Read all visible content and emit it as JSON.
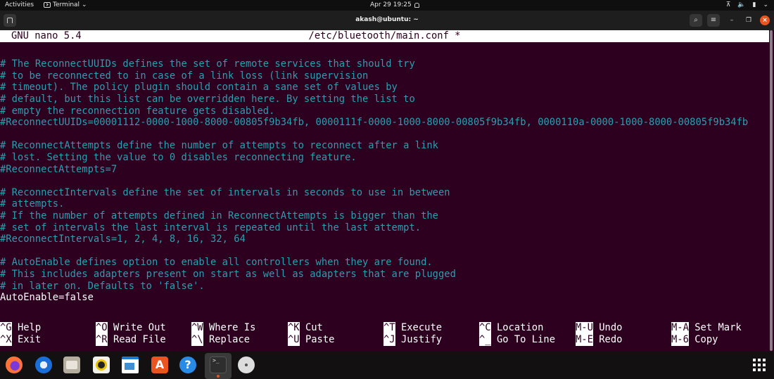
{
  "topbar": {
    "activities": "Activities",
    "app_menu": "Terminal",
    "app_menu_chevron": "⌄",
    "clock": "Apr 29  19:25",
    "tray": {
      "network_icon": "⊼",
      "volume_icon": "🔈",
      "battery_icon": "▮",
      "chevron_icon": "⌄"
    }
  },
  "window": {
    "title": "akash@ubuntu: ~",
    "search_icon": "⌕",
    "menu_icon": "≡",
    "minimize_icon": "–",
    "maximize_icon": "❐",
    "close_icon": "×"
  },
  "nano": {
    "version": "GNU nano 5.4",
    "filename": "/etc/bluetooth/main.conf *",
    "lines": [
      {
        "type": "blank",
        "text": ""
      },
      {
        "type": "comment",
        "text": "# The ReconnectUUIDs defines the set of remote services that should try"
      },
      {
        "type": "comment",
        "text": "# to be reconnected to in case of a link loss (link supervision"
      },
      {
        "type": "comment",
        "text": "# timeout). The policy plugin should contain a sane set of values by"
      },
      {
        "type": "comment",
        "text": "# default, but this list can be overridden here. By setting the list to"
      },
      {
        "type": "comment",
        "text": "# empty the reconnection feature gets disabled."
      },
      {
        "type": "comment",
        "text": "#ReconnectUUIDs=00001112-0000-1000-8000-00805f9b34fb, 0000111f-0000-1000-8000-00805f9b34fb, 0000110a-0000-1000-8000-00805f9b34fb"
      },
      {
        "type": "blank",
        "text": ""
      },
      {
        "type": "comment",
        "text": "# ReconnectAttempts define the number of attempts to reconnect after a link"
      },
      {
        "type": "comment",
        "text": "# lost. Setting the value to 0 disables reconnecting feature."
      },
      {
        "type": "comment",
        "text": "#ReconnectAttempts=7"
      },
      {
        "type": "blank",
        "text": ""
      },
      {
        "type": "comment",
        "text": "# ReconnectIntervals define the set of intervals in seconds to use in between"
      },
      {
        "type": "comment",
        "text": "# attempts."
      },
      {
        "type": "comment",
        "text": "# If the number of attempts defined in ReconnectAttempts is bigger than the"
      },
      {
        "type": "comment",
        "text": "# set of intervals the last interval is repeated until the last attempt."
      },
      {
        "type": "comment",
        "text": "#ReconnectIntervals=1, 2, 4, 8, 16, 32, 64"
      },
      {
        "type": "blank",
        "text": ""
      },
      {
        "type": "comment",
        "text": "# AutoEnable defines option to enable all controllers when they are found."
      },
      {
        "type": "comment",
        "text": "# This includes adapters present on start as well as adapters that are plugged"
      },
      {
        "type": "comment",
        "text": "# in later on. Defaults to 'false'."
      },
      {
        "type": "plain",
        "text": "AutoEnable=false"
      }
    ],
    "shortcuts": [
      [
        {
          "key": "^G",
          "label": "Help"
        },
        {
          "key": "^O",
          "label": "Write Out"
        },
        {
          "key": "^W",
          "label": "Where Is"
        },
        {
          "key": "^K",
          "label": "Cut"
        },
        {
          "key": "^T",
          "label": "Execute"
        },
        {
          "key": "^C",
          "label": "Location"
        },
        {
          "key": "M-U",
          "label": "Undo"
        },
        {
          "key": "M-A",
          "label": "Set Mark"
        }
      ],
      [
        {
          "key": "^X",
          "label": "Exit"
        },
        {
          "key": "^R",
          "label": "Read File"
        },
        {
          "key": "^\\",
          "label": "Replace"
        },
        {
          "key": "^U",
          "label": "Paste"
        },
        {
          "key": "^J",
          "label": "Justify"
        },
        {
          "key": "^_",
          "label": "Go To Line"
        },
        {
          "key": "M-E",
          "label": "Redo"
        },
        {
          "key": "M-6",
          "label": "Copy"
        }
      ]
    ]
  },
  "dock": {
    "items": [
      {
        "name": "firefox",
        "label": ""
      },
      {
        "name": "thunderbird",
        "label": ""
      },
      {
        "name": "files",
        "label": ""
      },
      {
        "name": "rhythmbox",
        "label": ""
      },
      {
        "name": "libreoffice-writer",
        "label": ""
      },
      {
        "name": "ubuntu-software",
        "label": "A"
      },
      {
        "name": "help",
        "label": "?"
      },
      {
        "name": "terminal",
        "label": ">_"
      },
      {
        "name": "disc",
        "label": ""
      }
    ]
  },
  "colors": {
    "terminal_bg": "#2c001e",
    "comment": "#2a9faf",
    "accent": "#e95420"
  }
}
